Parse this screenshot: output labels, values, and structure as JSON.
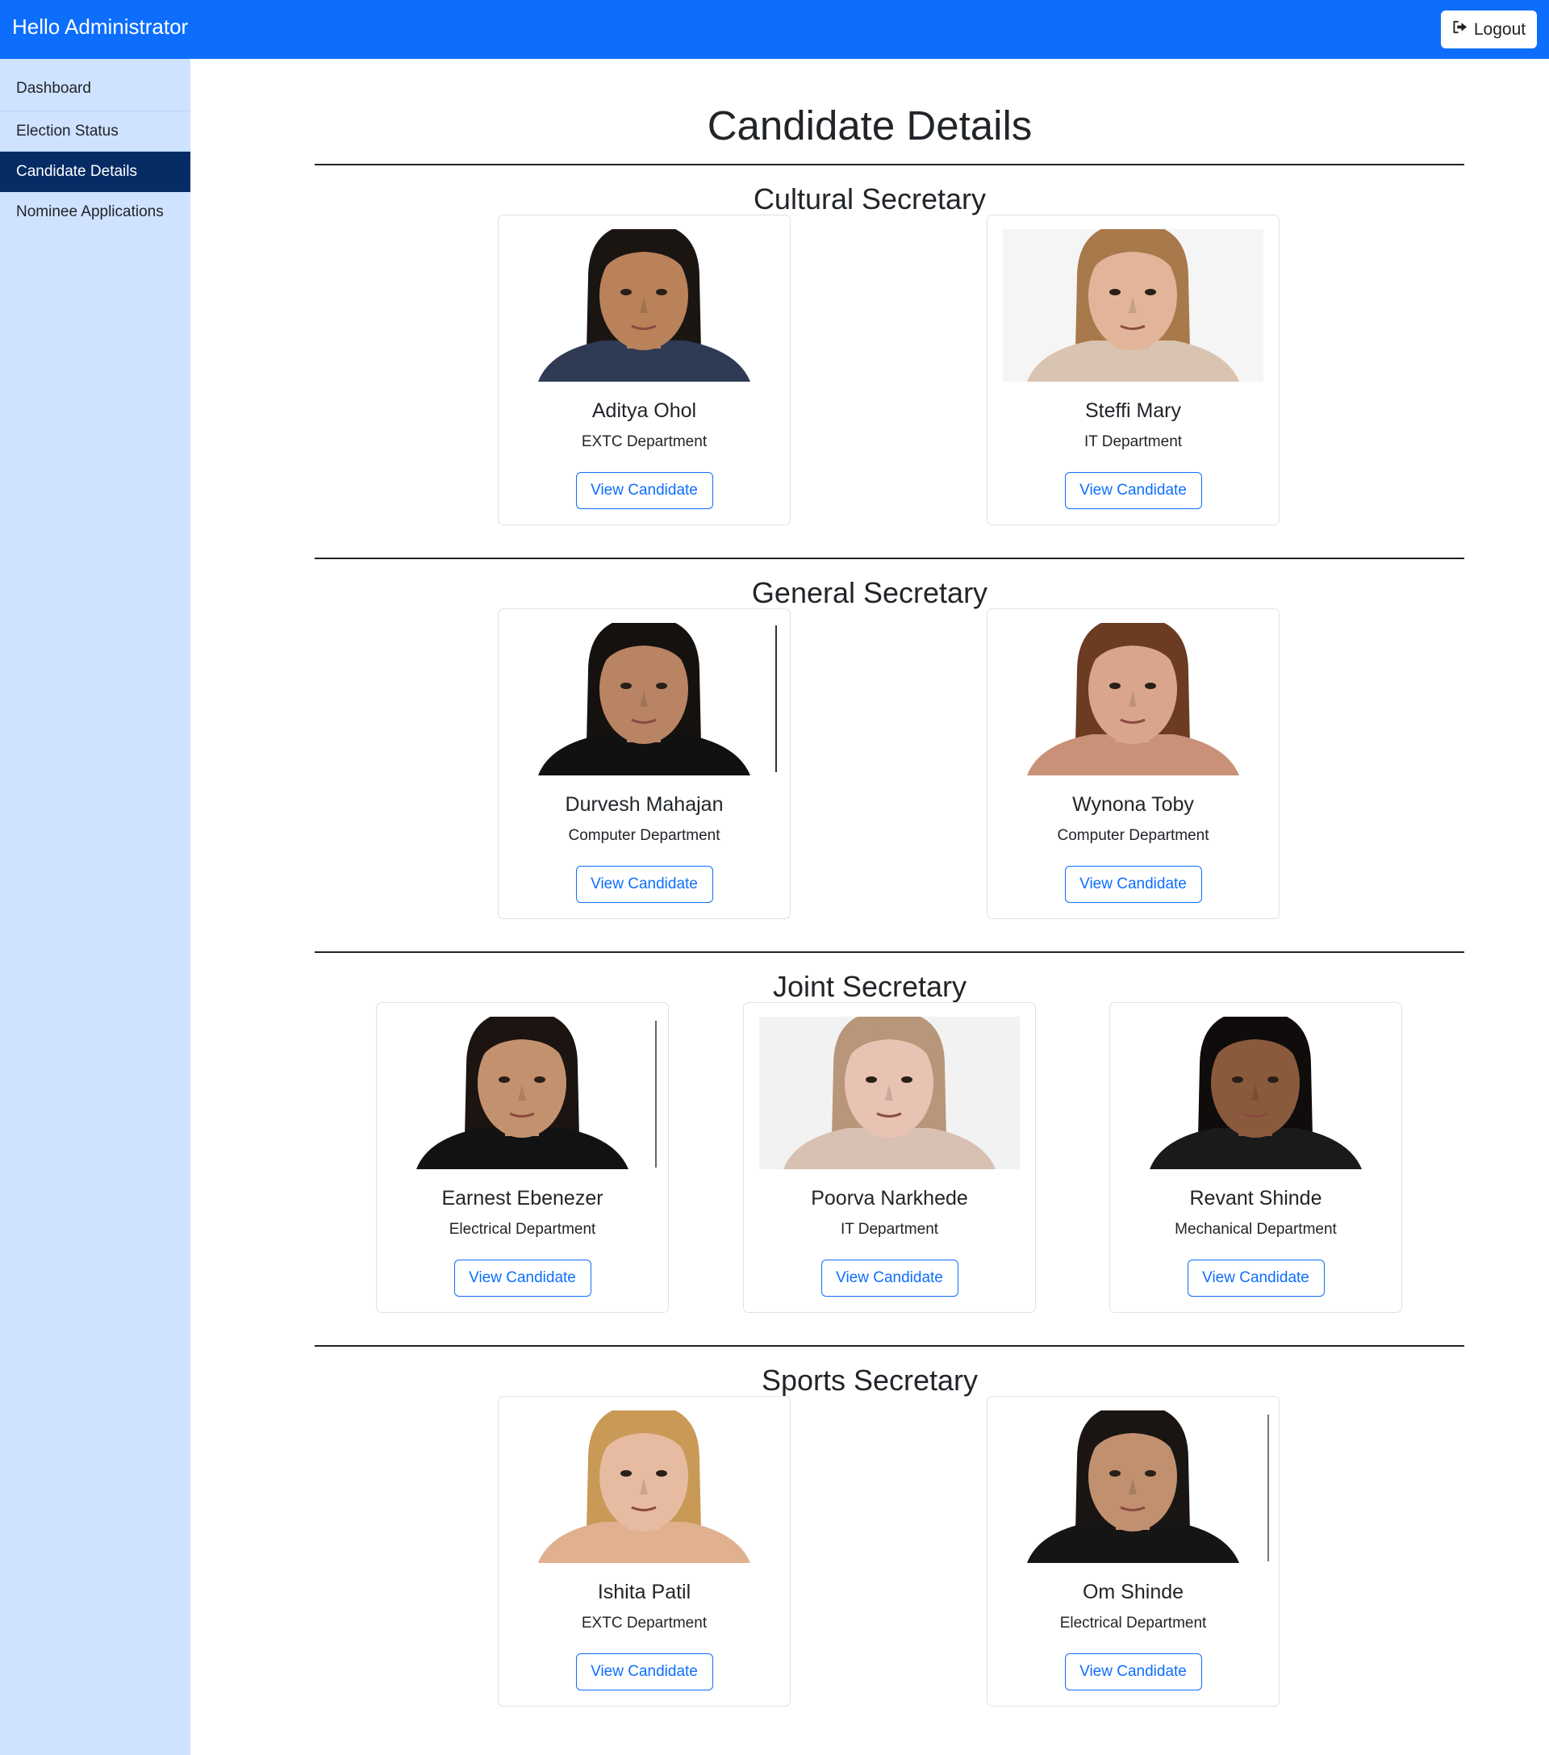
{
  "header": {
    "greeting": "Hello Administrator",
    "logout_label": "Logout"
  },
  "sidebar": {
    "items": [
      {
        "label": "Dashboard"
      },
      {
        "label": "Election Status"
      },
      {
        "label": "Candidate Details"
      },
      {
        "label": "Nominee Applications"
      }
    ]
  },
  "main": {
    "title": "Candidate Details",
    "view_label": "View Candidate",
    "sections": [
      {
        "title": "Cultural Secretary",
        "candidates": [
          {
            "name": "Aditya Ohol",
            "department": "EXTC Department",
            "skin": "#b9825a",
            "hair": "#1b1512",
            "clothes": "#2f3a55",
            "bg": "#ffffff"
          },
          {
            "name": "Steffi Mary",
            "department": "IT Department",
            "skin": "#e2b59a",
            "hair": "#a8794a",
            "clothes": "#d9c3b1",
            "bg": "#f5f5f5"
          }
        ]
      },
      {
        "title": "General Secretary",
        "candidates": [
          {
            "name": "Durvesh Mahajan",
            "department": "Computer Department",
            "skin": "#b98464",
            "hair": "#15110e",
            "clothes": "#111111",
            "bg": "#ffffff"
          },
          {
            "name": "Wynona Toby",
            "department": "Computer Department",
            "skin": "#d9a68d",
            "hair": "#6b3b22",
            "clothes": "#c99177",
            "bg": "#ffffff"
          }
        ]
      },
      {
        "title": "Joint Secretary",
        "candidates": [
          {
            "name": "Earnest Ebenezer",
            "department": "Electrical Department",
            "skin": "#c4916f",
            "hair": "#1c1410",
            "clothes": "#121212",
            "bg": "#ffffff"
          },
          {
            "name": "Poorva Narkhede",
            "department": "IT Department",
            "skin": "#e8c2b2",
            "hair": "#b8967a",
            "clothes": "#d8c0b2",
            "bg": "#f2f2f2"
          },
          {
            "name": "Revant Shinde",
            "department": "Mechanical Department",
            "skin": "#8a5a3c",
            "hair": "#0f0c0b",
            "clothes": "#1a1a1a",
            "bg": "#ffffff"
          }
        ]
      },
      {
        "title": "Sports Secretary",
        "candidates": [
          {
            "name": "Ishita Patil",
            "department": "EXTC Department",
            "skin": "#e6bba1",
            "hair": "#c89a55",
            "clothes": "#e0b08f",
            "bg": "#ffffff"
          },
          {
            "name": "Om Shinde",
            "department": "Electrical Department",
            "skin": "#c0906f",
            "hair": "#1a1512",
            "clothes": "#151515",
            "bg": "#ffffff"
          }
        ]
      }
    ]
  }
}
